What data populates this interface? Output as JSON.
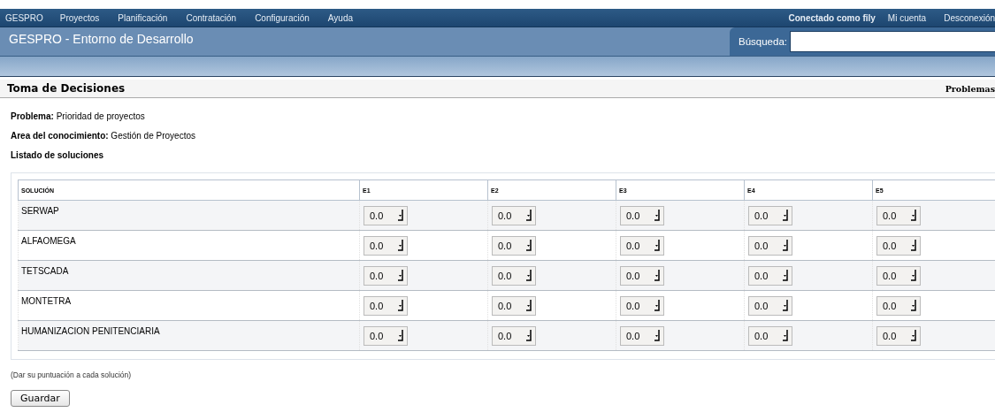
{
  "nav": {
    "brand": "GESPRO",
    "items": [
      "Proyectos",
      "Planificación",
      "Contratación",
      "Configuración",
      "Ayuda"
    ],
    "user_prefix": "Conectado como",
    "user": "fily",
    "links": [
      "Mi cuenta",
      "Desconexión"
    ]
  },
  "header": {
    "title": "GESPRO - Entorno de Desarrollo",
    "search_label": "Búsqueda:"
  },
  "page": {
    "title": "Toma de Decisiones",
    "right_link": "Problemas"
  },
  "info": [
    {
      "label": "Problema:",
      "value": "Prioridad de proyectos"
    },
    {
      "label": "Area del conocimiento:",
      "value": "Gestión de Proyectos"
    }
  ],
  "section": "Listado de soluciones",
  "table": {
    "columns": [
      "SOLUCIÓN",
      "E1",
      "E2",
      "E3",
      "E4",
      "E5"
    ],
    "rows": [
      {
        "name": "SERWAP",
        "scores": [
          "0.0",
          "0.0",
          "0.0",
          "0.0",
          "0.0"
        ]
      },
      {
        "name": "ALFAOMEGA",
        "scores": [
          "0.0",
          "0.0",
          "0.0",
          "0.0",
          "0.0"
        ]
      },
      {
        "name": "TETSCADA",
        "scores": [
          "0.0",
          "0.0",
          "0.0",
          "0.0",
          "0.0"
        ]
      },
      {
        "name": "MONTETRA",
        "scores": [
          "0.0",
          "0.0",
          "0.0",
          "0.0",
          "0.0"
        ]
      },
      {
        "name": "HUMANIZACION PENITENCIARIA",
        "scores": [
          "0.0",
          "0.0",
          "0.0",
          "0.0",
          "0.0"
        ]
      }
    ]
  },
  "hint": "(Dar su puntuación a cada solución)",
  "save_button": "Guardar"
}
